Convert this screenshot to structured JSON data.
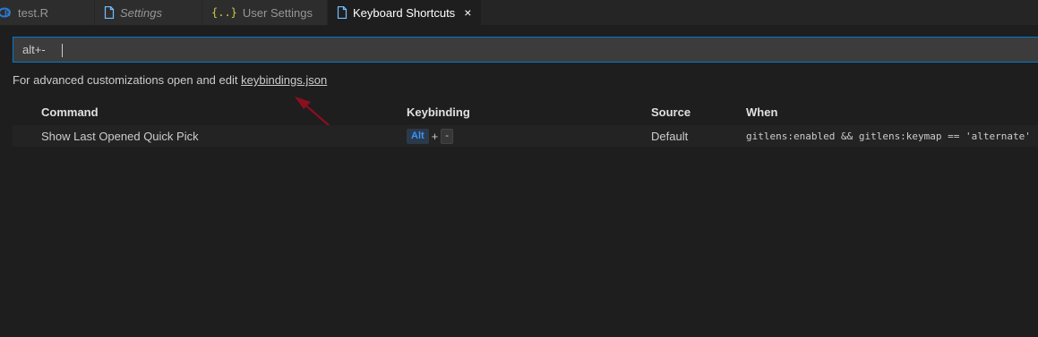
{
  "tabs": [
    {
      "label": "test.R",
      "icon": "r-file-icon",
      "active": false,
      "italic": false
    },
    {
      "label": "Settings",
      "icon": "file-icon",
      "active": false,
      "italic": true
    },
    {
      "label": "User Settings",
      "icon": "json-braces-icon",
      "active": false,
      "italic": false
    },
    {
      "label": "Keyboard Shortcuts",
      "icon": "file-icon",
      "active": true,
      "italic": false,
      "close": "×"
    }
  ],
  "search": {
    "value": "alt+-"
  },
  "hint": {
    "prefix": "For advanced customizations open and edit ",
    "link": "keybindings.json"
  },
  "table": {
    "headers": {
      "command": "Command",
      "keybinding": "Keybinding",
      "source": "Source",
      "when": "When"
    },
    "rows": [
      {
        "command": "Show Last Opened Quick Pick",
        "keys": [
          "Alt",
          "-"
        ],
        "key_separator": "+",
        "source": "Default",
        "when": "gitlens:enabled && gitlens:keymap == 'alternate'"
      }
    ]
  },
  "colors": {
    "accent": "#007acc",
    "arrow": "#8b0f1f",
    "alt_key": "#3794ff",
    "r_icon": "#2a7bd4",
    "json_icon": "#cbcb41"
  }
}
